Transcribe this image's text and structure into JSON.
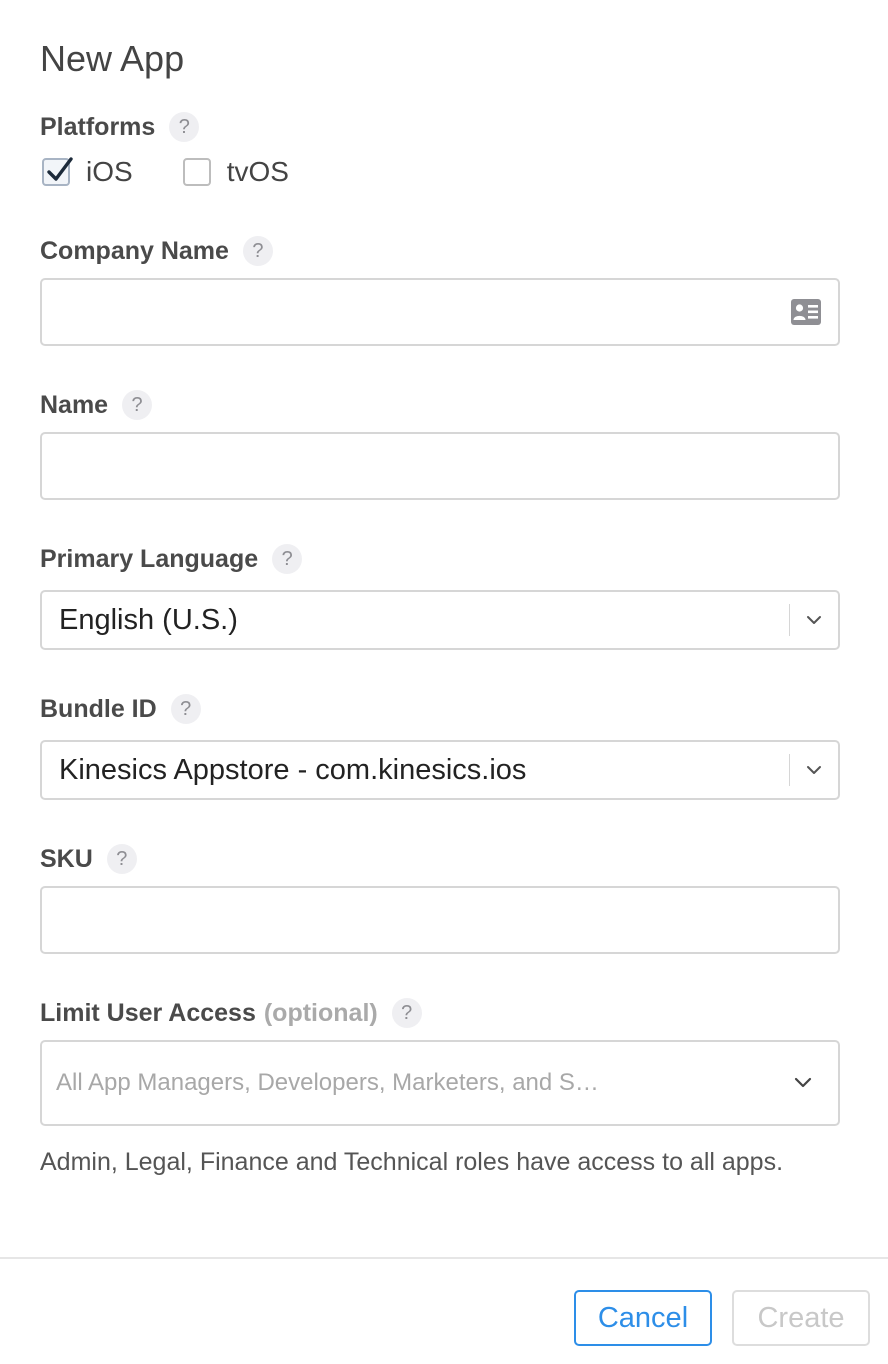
{
  "dialog": {
    "title": "New App"
  },
  "platforms": {
    "label": "Platforms",
    "help": "?",
    "options": [
      {
        "label": "iOS",
        "checked": true
      },
      {
        "label": "tvOS",
        "checked": false
      }
    ]
  },
  "company_name": {
    "label": "Company Name",
    "help": "?",
    "value": "",
    "icon": "contact-card-icon"
  },
  "name": {
    "label": "Name",
    "help": "?",
    "value": ""
  },
  "primary_language": {
    "label": "Primary Language",
    "help": "?",
    "value": "English (U.S.)"
  },
  "bundle_id": {
    "label": "Bundle ID",
    "help": "?",
    "value": "Kinesics Appstore - com.kinesics.ios"
  },
  "sku": {
    "label": "SKU",
    "help": "?",
    "value": ""
  },
  "limit_user_access": {
    "label": "Limit User Access",
    "optional": "(optional)",
    "help": "?",
    "placeholder": "All App Managers, Developers, Marketers, and S…",
    "note": "Admin, Legal, Finance and Technical roles have access to all apps."
  },
  "footer": {
    "cancel_label": "Cancel",
    "create_label": "Create"
  },
  "colors": {
    "accent": "#2d8ee8",
    "disabled": "#c8c8c8",
    "border": "#d6d6d6"
  }
}
